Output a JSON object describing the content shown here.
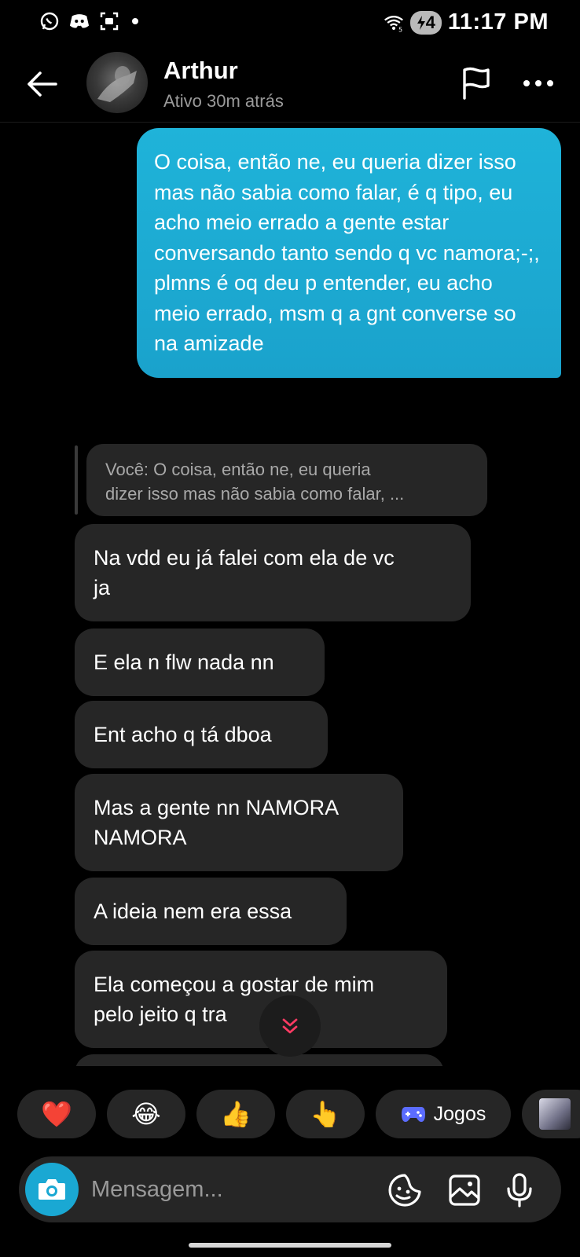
{
  "status_bar": {
    "time": "11:17 PM",
    "battery": "4",
    "icons": [
      "whatsapp-icon",
      "discord-icon",
      "screenshot-icon",
      "wifi-icon",
      "battery-charging-icon"
    ]
  },
  "header": {
    "contact_name": "Arthur",
    "contact_status": "Ativo 30m atrás",
    "icons": [
      "back-arrow-icon",
      "flag-icon",
      "more-icon"
    ]
  },
  "messages": {
    "outgoing": "O coisa, então ne, eu queria dizer isso mas não sabia como falar, é q tipo, eu acho meio errado a gente estar conversando tanto sendo q vc namora;-;, plmns é oq deu p entender, eu acho meio errado, msm q a gnt converse so na amizade",
    "reply_quote_line1": "Você: O coisa, então ne, eu queria",
    "reply_quote_line2": "dizer isso mas não sabia como falar, ...",
    "incoming": [
      {
        "line1": "Na vdd eu já falei com ela de vc",
        "line2": "ja"
      },
      {
        "line1": "E ela n flw nada nn",
        "line2": ""
      },
      {
        "line1": "Ent acho q tá dboa",
        "line2": ""
      },
      {
        "line1": "Mas a gente nn NAMORA",
        "line2": "NAMORA"
      },
      {
        "line1": "A ideia nem era essa",
        "line2": ""
      },
      {
        "line1": "Ela começou a gostar de mim",
        "line2": "pelo jeito q tra"
      },
      {
        "line1": "",
        "line2": ""
      }
    ]
  },
  "reactions": {
    "heart": "❤️",
    "laugh": "😂",
    "thumbs_up": "👍",
    "point": "👆",
    "games_label": "Jogos"
  },
  "composer": {
    "placeholder": "Mensagem..."
  },
  "colors": {
    "background": "#000000",
    "outgoing_bubble": "#1aa8d3",
    "incoming_bubble": "#262626",
    "accent_blue": "#1aa8d3",
    "scroll_chevron": "#ff3b63"
  }
}
